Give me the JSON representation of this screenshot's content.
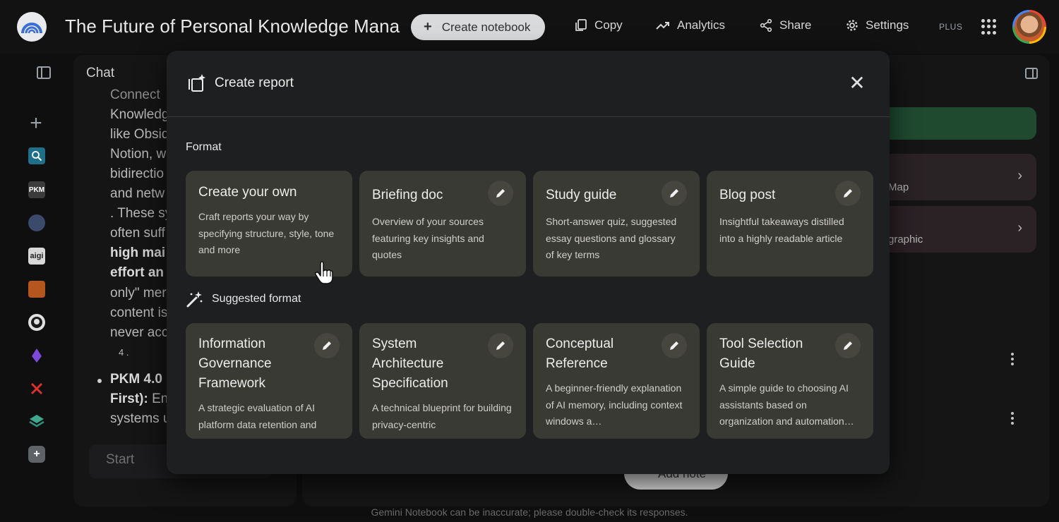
{
  "header": {
    "title": "The Future of Personal Knowledge Mana",
    "create_notebook": "Create notebook",
    "copy": "Copy",
    "analytics": "Analytics",
    "share": "Share",
    "settings": "Settings",
    "plan_badge": "PLUS"
  },
  "chat": {
    "label": "Chat",
    "lines": [
      "Connect",
      "Knowledg",
      "like Obsid",
      "Notion, w",
      "bidirectio",
      "and netw",
      ". These sy",
      "often suff"
    ],
    "bold_lines": [
      "high mai",
      "effort an"
    ],
    "lines2": [
      "only\" mer",
      "content is",
      "never acc"
    ],
    "citation": "4 .",
    "bullet_bold_1": "PKM 4.0",
    "bullet_bold_2": "First):",
    "bullet_rest": "En",
    "line_last": "systems u",
    "input_placeholder": "Start"
  },
  "studio": {
    "card_map": "Map",
    "card_infographic": "graphic",
    "add_note": "Add note"
  },
  "footer": "Gemini Notebook can be inaccurate; please double-check its responses.",
  "modal": {
    "title": "Create report",
    "format_label": "Format",
    "suggested_label": "Suggested format",
    "formats": [
      {
        "title": "Create your own",
        "desc": "Craft reports your way by specifying structure, style, tone and more"
      },
      {
        "title": "Briefing doc",
        "desc": "Overview of your sources featuring key insights and quotes"
      },
      {
        "title": "Study guide",
        "desc": "Short-answer quiz, suggested essay questions and glossary of key terms"
      },
      {
        "title": "Blog post",
        "desc": "Insightful takeaways distilled into a highly readable article"
      }
    ],
    "suggested": [
      {
        "title": "Information Governance Framework",
        "desc": "A strategic evaluation of AI platform data retention and"
      },
      {
        "title": "System Architecture Specification",
        "desc": "A technical blueprint for building privacy-centric"
      },
      {
        "title": "Conceptual Reference",
        "desc": "A beginner-friendly explanation of AI memory, including context windows a…"
      },
      {
        "title": "Tool Selection Guide",
        "desc": "A simple guide to choosing AI assistants based on organization and automation…"
      }
    ]
  },
  "colors": {
    "background": "#0f0f10",
    "modal": "#1e1f20",
    "card": "#3a3a34",
    "accent_green": "#1f4a30"
  }
}
